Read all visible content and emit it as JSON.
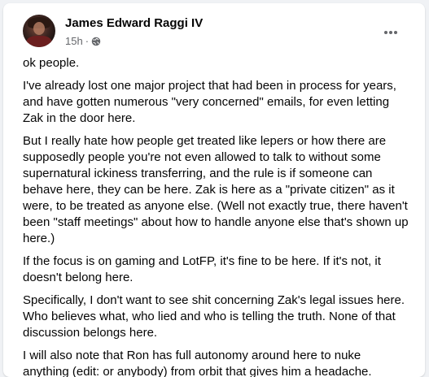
{
  "post": {
    "author": "James Edward Raggi IV",
    "time": "15h",
    "separator": "·",
    "privacy_icon": "globe-icon",
    "more_icon": "more-horizontal-icon",
    "paragraphs": [
      "ok people.",
      "I've already lost one major project that had been in process for years, and have gotten numerous \"very concerned\" emails, for even letting Zak in the door here.",
      "But I really hate how people get treated like lepers or how there are supposedly people you're not even allowed to talk to without some supernatural ickiness transferring, and the rule is if someone can behave here, they can be here. Zak is here as a \"private citizen\" as it were, to be treated as anyone else. (Well not exactly true, there haven't been \"staff meetings\" about how to handle anyone else that's shown up here.)",
      "If the focus is on gaming and LotFP, it's fine to be here. If it's not, it doesn't belong here.",
      "Specifically, I don't want to see shit concerning Zak's legal issues here. Who believes what, who lied and who is telling the truth. None of that discussion belongs here.",
      "I will also note that Ron has full autonomy around here to nuke anything (edit: or anybody) from orbit that gives him a headache."
    ]
  }
}
